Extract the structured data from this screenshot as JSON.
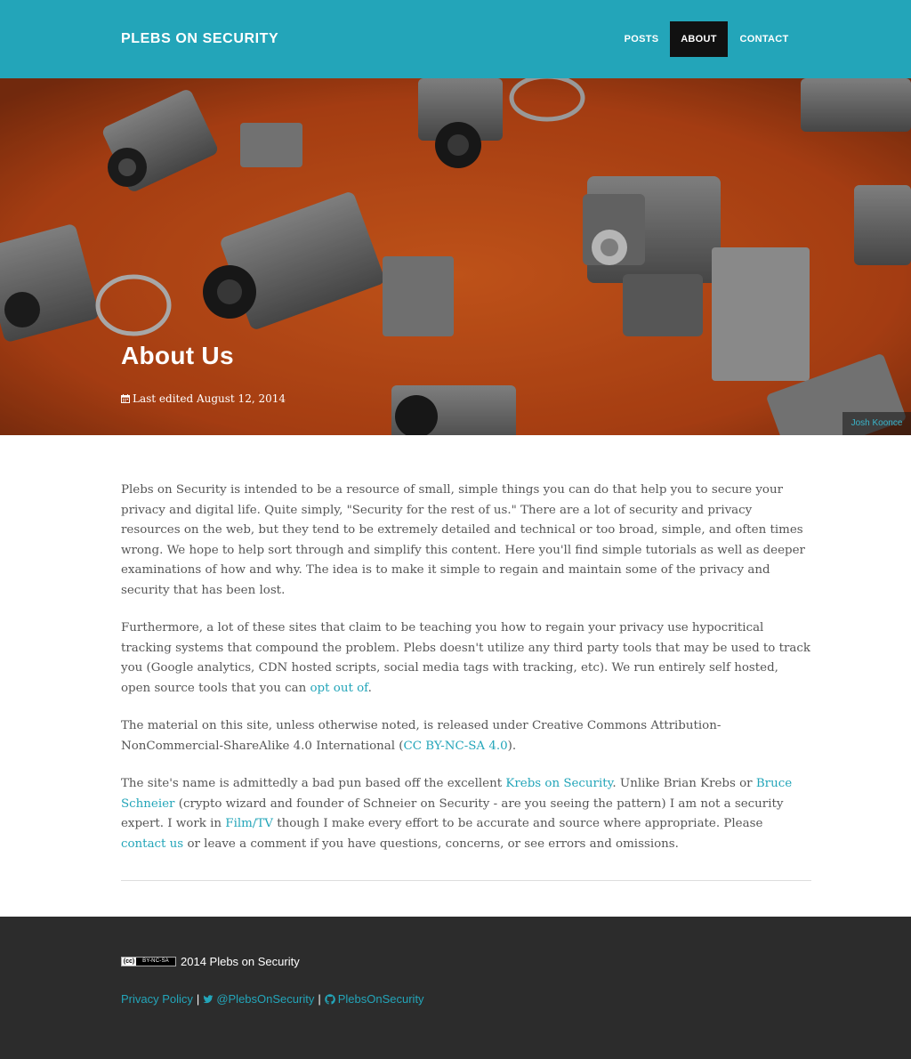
{
  "navbar": {
    "brand": "PLEBS ON SECURITY",
    "items": [
      {
        "label": "POSTS",
        "active": false
      },
      {
        "label": "ABOUT",
        "active": true
      },
      {
        "label": "CONTACT",
        "active": false
      }
    ]
  },
  "hero": {
    "title": "About Us",
    "meta_icon": "calendar-icon",
    "meta": "Last edited August 12, 2014",
    "photo_credit": "Josh Koonce"
  },
  "content": {
    "p1": "Plebs on Security is intended to be a resource of small, simple things you can do that help you to secure your privacy and digital life. Quite simply, \"Security for the rest of us.\" There are a lot of security and privacy resources on the web, but they tend to be extremely detailed and technical or too broad, simple, and often times wrong. We hope to help sort through and simplify this content. Here you'll find simple tutorials as well as deeper examinations of how and why. The idea is to make it simple to regain and maintain some of the privacy and security that has been lost.",
    "p2_text": "Furthermore, a lot of these sites that claim to be teaching you how to regain your privacy use hypocritical tracking systems that compound the problem. Plebs doesn't utilize any third party tools that may be used to track you (Google analytics, CDN hosted scripts, social media tags with tracking, etc). We run entirely self hosted, open source tools that you can ",
    "p2_link": "opt out of",
    "p2_end": ".",
    "p3_text": "The material on this site, unless otherwise noted, is released under Creative Commons Attribution-NonCommercial-ShareAlike 4.0 International (",
    "p3_link": "CC BY-NC-SA 4.0",
    "p3_end": ").",
    "p4_a": "The site's name is admittedly a bad pun based off the excellent ",
    "p4_link1": "Krebs on Security",
    "p4_b": ". Unlike Brian Krebs or ",
    "p4_link2": "Bruce Schneier",
    "p4_c": " (crypto wizard and founder of Schneier on Security - are you seeing the pattern) I am not a security expert. I work in ",
    "p4_link3": "Film/TV",
    "p4_d": " though I make every effort to be accurate and source where appropriate. Please ",
    "p4_link4": "contact us",
    "p4_e": " or leave a comment if you have questions, concerns, or see errors and omissions."
  },
  "footer": {
    "cc_badge_cc": "(cc)",
    "cc_badge_license": "BY-NC-SA",
    "copyright": "2014 Plebs on Security",
    "privacy_policy": "Privacy Policy",
    "separator": "|",
    "twitter": "@PlebsOnSecurity",
    "github": "PlebsOnSecurity"
  },
  "colors": {
    "accent": "#23a5b9",
    "nav_active": "#111111",
    "footer_bg": "#2c2c2c",
    "hero_orange": "#d9541f"
  }
}
